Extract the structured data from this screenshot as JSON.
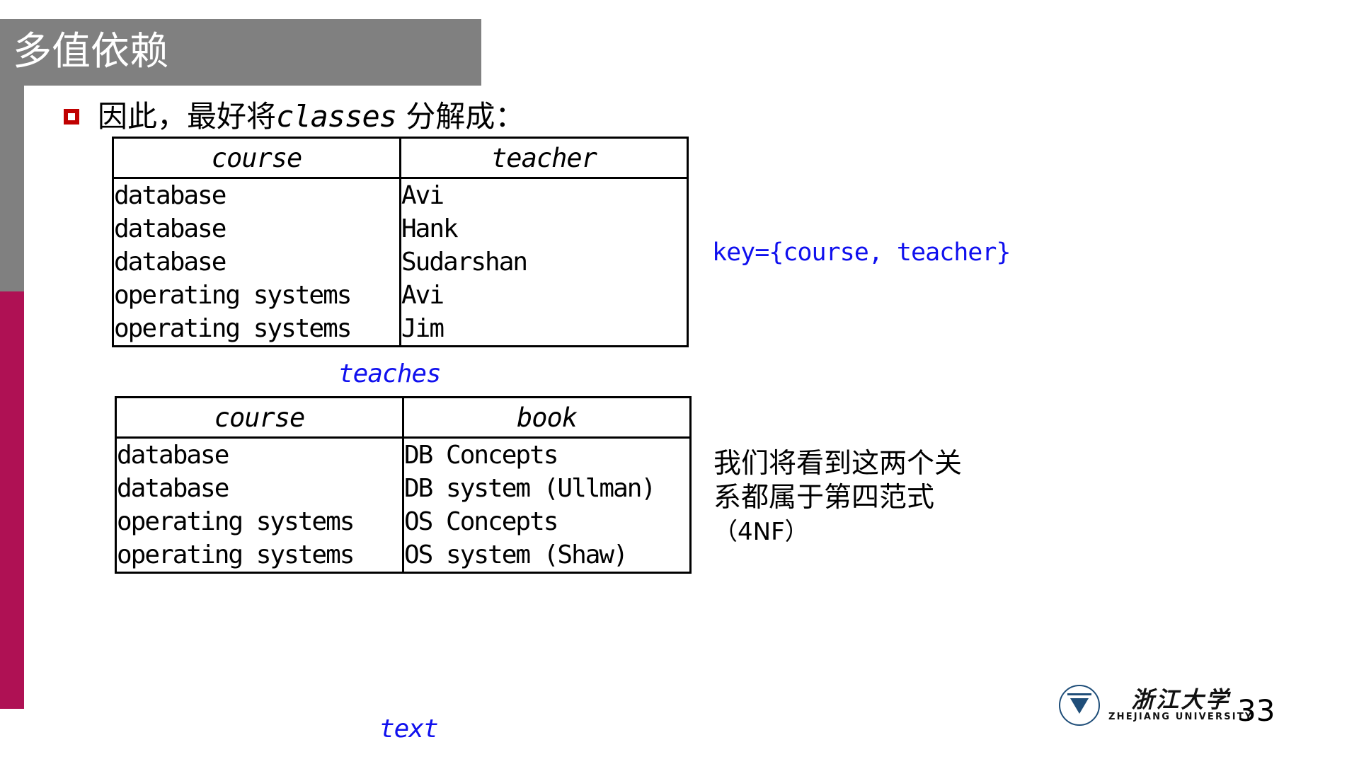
{
  "slide": {
    "title": "多值依赖",
    "page_number": "33",
    "accent_gray": "#808080",
    "accent_crimson": "#AF1154",
    "bullet_marker_color": "#C00000",
    "annotation_blue": "#1010EE"
  },
  "bullet": {
    "lead": "因此，最好将",
    "emphasis": "classes",
    "trail": " 分解成："
  },
  "tables": [
    {
      "name": "teaches",
      "caption": "teaches",
      "columns": [
        "course",
        "teacher"
      ],
      "rows": [
        [
          "database",
          "Avi"
        ],
        [
          "database",
          "Hank"
        ],
        [
          "database",
          "Sudarshan"
        ],
        [
          "operating systems",
          "Avi"
        ],
        [
          "operating systems",
          "Jim"
        ]
      ],
      "course_cell_text": "database\ndatabase\ndatabase\noperating systems\noperating systems",
      "value_cell_text": "Avi\nHank\nSudarshan\nAvi\nJim"
    },
    {
      "name": "text",
      "caption": "text",
      "columns": [
        "course",
        "book"
      ],
      "rows": [
        [
          "database",
          "DB Concepts"
        ],
        [
          "database",
          "DB system (Ullman)"
        ],
        [
          "operating systems",
          "OS Concepts"
        ],
        [
          "operating systems",
          "OS system (Shaw)"
        ]
      ],
      "course_cell_text": "database\ndatabase\noperating systems\noperating systems",
      "value_cell_text": "DB Concepts\nDB system (Ullman)\nOS Concepts\nOS system (Shaw)"
    }
  ],
  "annotations": {
    "key_note": "key={course, teacher}",
    "fourth_nf_line1": "我们将看到这两个关",
    "fourth_nf_line2": "系都属于第四范式",
    "fourth_nf_line3": "（4NF）"
  },
  "footer": {
    "logo_cn": "浙江大学",
    "logo_en": "ZHEJIANG UNIVERSITY"
  }
}
